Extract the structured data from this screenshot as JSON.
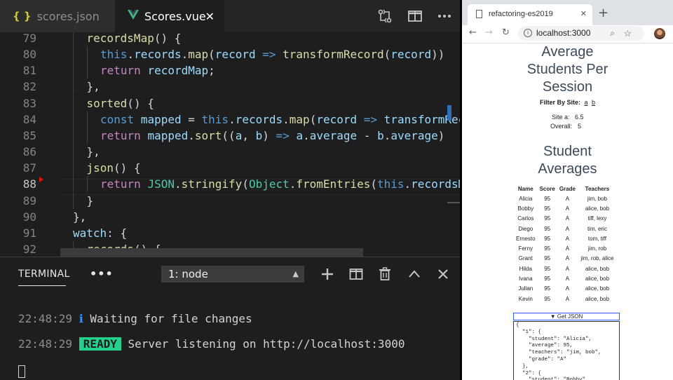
{
  "editor": {
    "tabs": [
      {
        "label": "scores.json",
        "icon": "json-braces-icon"
      },
      {
        "label": "Scores.vue",
        "icon": "vue-logo-icon",
        "active": true
      }
    ],
    "lines": [
      {
        "n": "79",
        "code": "recordsMap() {"
      },
      {
        "n": "80",
        "code": "this.records.map(record => transformRecord(record))"
      },
      {
        "n": "81",
        "code": "return recordMap;"
      },
      {
        "n": "82",
        "code": "},"
      },
      {
        "n": "83",
        "code": "sorted() {"
      },
      {
        "n": "84",
        "code": "const mapped = this.records.map(record => transformReco"
      },
      {
        "n": "85",
        "code": "return mapped.sort((a, b) => a.average - b.average)"
      },
      {
        "n": "86",
        "code": "},"
      },
      {
        "n": "87",
        "code": "json() {"
      },
      {
        "n": "88",
        "code": "return JSON.stringify(Object.fromEntries(this.recordsMa"
      },
      {
        "n": "89",
        "code": "}"
      },
      {
        "n": "90",
        "code": "},"
      },
      {
        "n": "91",
        "code": "watch: {"
      },
      {
        "n": "92",
        "code": "records() {"
      }
    ]
  },
  "terminal": {
    "title": "TERMINAL",
    "more": "•••",
    "select_value": "1: node",
    "lines": [
      {
        "time": "22:48:29",
        "badge": "ℹ",
        "text": "Waiting for file changes"
      },
      {
        "time": "22:48:29",
        "badge": "READY",
        "text": "Server listening on http://localhost:3000"
      }
    ]
  },
  "browser": {
    "tab_title": "refactoring-es2019",
    "url": "localhost:3000",
    "page": {
      "heading1": [
        "Average",
        "Students Per",
        "Session"
      ],
      "filter_label": "Filter By Site:",
      "filter_links": [
        "a",
        "b"
      ],
      "stats": [
        {
          "label": "Site a:",
          "value": "6.5"
        },
        {
          "label": "Overall:",
          "value": "5"
        }
      ],
      "heading2": [
        "Student",
        "Averages"
      ],
      "table": {
        "headers": [
          "Name",
          "Score",
          "Grade",
          "Teachers"
        ],
        "rows": [
          [
            "Alicia",
            "95",
            "A",
            "jim, bob"
          ],
          [
            "Bobby",
            "95",
            "A",
            "alice, bob"
          ],
          [
            "Carlos",
            "95",
            "A",
            "tiff, lexy"
          ],
          [
            "Diego",
            "95",
            "A",
            "tim, eric"
          ],
          [
            "Ernesto",
            "95",
            "A",
            "tom, tiff"
          ],
          [
            "Ferny",
            "95",
            "A",
            "jim, rob"
          ],
          [
            "Grant",
            "95",
            "A",
            "jim, rob, alice"
          ],
          [
            "Hilda",
            "95",
            "A",
            "alice, bob"
          ],
          [
            "Ivana",
            "95",
            "A",
            "alice, bob"
          ],
          [
            "Julian",
            "95",
            "A",
            "alice, bob"
          ],
          [
            "Kevin",
            "95",
            "A",
            "alice, bob"
          ]
        ]
      },
      "get_json_label": "▼ Get JSON",
      "json_text": "{\n  \"1\": {\n    \"student\": \"Alicia\",\n    \"average\": 95,\n    \"teachers\": \"jim, bob\",\n    \"grade\": \"A\"\n  },\n  \"2\": {\n    \"student\": \"Bobby\","
    }
  }
}
